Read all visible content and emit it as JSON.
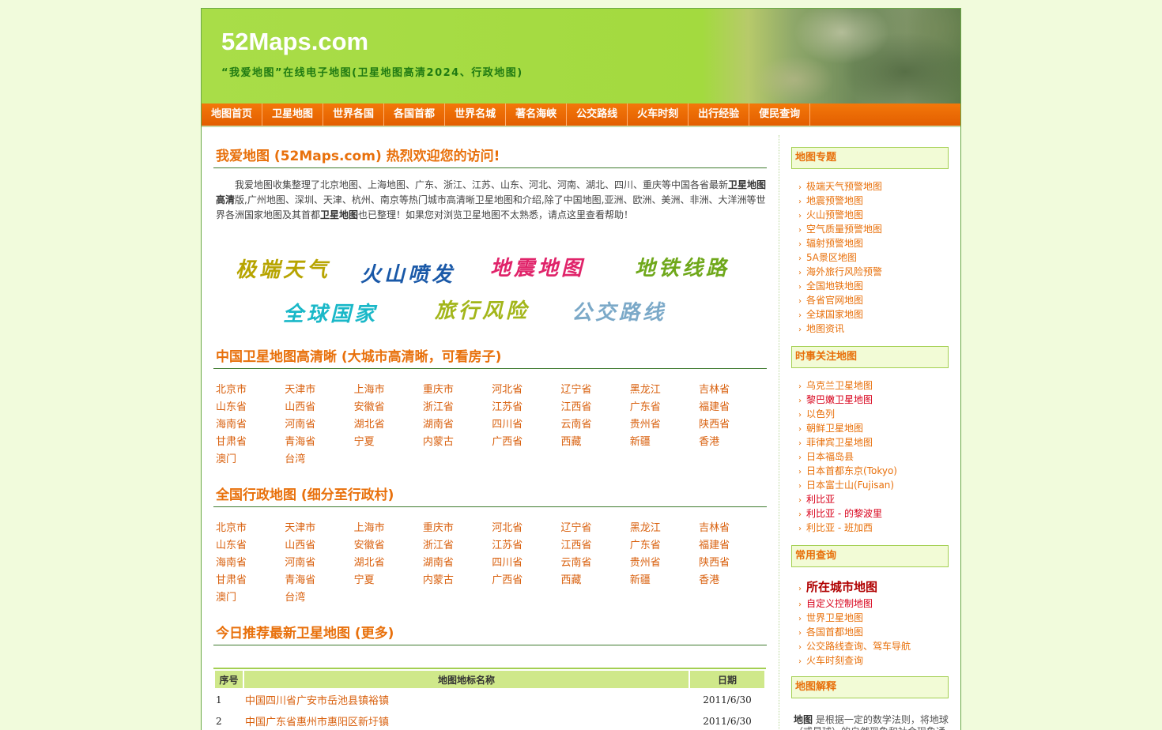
{
  "header": {
    "title": "52Maps.com",
    "slogan": "“我爱地图”在线电子地图(卫星地图高清2024、行政地图)"
  },
  "nav": [
    "地图首页",
    "卫星地图",
    "世界各国",
    "各国首都",
    "世界名城",
    "著名海峡",
    "公交路线",
    "火车时刻",
    "出行经验",
    "便民查询"
  ],
  "welcome": {
    "title": "我爱地图 (52Maps.com) 热烈欢迎您的访问!",
    "text_1": "我爱地图收集整理了北京地图、上海地图、广东、浙江、江苏、山东、河北、河南、湖北、四川、重庆等中国各省最新",
    "bold_1": "卫星地图高清",
    "text_2": "版,广州地图、深圳、天津、杭州、南京等热门城市高清晰卫星地图和介绍,除了中国地图,亚洲、欧洲、美洲、非洲、大洋洲等世界各洲国家地图及其首都",
    "bold_2": "卫星地图",
    "text_3": "也已整理！如果您对浏览卫星地图不太熟悉，请点这里查看帮助！"
  },
  "callouts": [
    {
      "label": "极端天气",
      "color": "#b7a400"
    },
    {
      "label": "火山喷发",
      "color": "#1a59a8"
    },
    {
      "label": "地震地图",
      "color": "#e0246a"
    },
    {
      "label": "地铁线路",
      "color": "#6fa81b"
    },
    {
      "label": "全球国家",
      "color": "#1ab8c8"
    },
    {
      "label": "旅行风险",
      "color": "#a3b61a"
    },
    {
      "label": "公交路线",
      "color": "#7ba9c8"
    }
  ],
  "sections": {
    "satellite_title": "中国卫星地图高清晰 (大城市高清晰，可看房子)",
    "admin_title": "全国行政地图 (细分至行政村)",
    "recommend_title": "今日推荐最新卫星地图 (更多)"
  },
  "provinces": [
    "北京市",
    "天津市",
    "上海市",
    "重庆市",
    "河北省",
    "辽宁省",
    "黑龙江",
    "吉林省",
    "山东省",
    "山西省",
    "安徽省",
    "浙江省",
    "江苏省",
    "江西省",
    "广东省",
    "福建省",
    "海南省",
    "河南省",
    "湖北省",
    "湖南省",
    "四川省",
    "云南省",
    "贵州省",
    "陕西省",
    "甘肃省",
    "青海省",
    "宁夏",
    "内蒙古",
    "广西省",
    "西藏",
    "新疆",
    "香港",
    "澳门",
    "台湾"
  ],
  "table": {
    "headers": [
      "序号",
      "地图地标名称",
      "日期"
    ],
    "rows": [
      {
        "num": "1",
        "name": "中国四川省广安市岳池县镇裕镇",
        "date": "2011/6/30"
      },
      {
        "num": "2",
        "name": "中国广东省惠州市惠阳区新圩镇",
        "date": "2011/6/30"
      }
    ]
  },
  "sidebar": {
    "topics_title": "地图专题",
    "topics": [
      "极端天气预警地图",
      "地震预警地图",
      "火山预警地图",
      "空气质量预警地图",
      "辐射预警地图",
      "5A景区地图",
      "海外旅行风险预警",
      "全国地铁地图",
      "各省官网地图",
      "全球国家地图",
      "地图资讯"
    ],
    "news_title": "时事关注地图",
    "news": [
      {
        "label": "乌克兰卫星地图",
        "red": false
      },
      {
        "label": "黎巴嫩卫星地图",
        "red": true
      },
      {
        "label": "以色列",
        "red": false
      },
      {
        "label": "朝鲜卫星地图",
        "red": false
      },
      {
        "label": "菲律宾卫星地图",
        "red": false
      },
      {
        "label": "日本福岛县",
        "red": false
      },
      {
        "label": "日本首都东京(Tokyo)",
        "red": false
      },
      {
        "label": "日本富士山(Fujisan)",
        "red": false
      },
      {
        "label": "利比亚",
        "red": true
      },
      {
        "label": "利比亚 - 的黎波里",
        "red": true
      },
      {
        "label": "利比亚 - 班加西",
        "red": false
      }
    ],
    "query_title": "常用查询",
    "query": [
      {
        "label": "所在城市地图",
        "style": "big"
      },
      {
        "label": "自定义控制地图",
        "style": "red"
      },
      {
        "label": "世界卫星地图",
        "style": ""
      },
      {
        "label": "各国首都地图",
        "style": ""
      },
      {
        "label": "公交路线查询、驾车导航",
        "style": ""
      },
      {
        "label": "火车时刻查询",
        "style": ""
      }
    ],
    "explain_title": "地图解释",
    "explain_bold": "地图",
    "explain_text": " 是根据一定的数学法则，将地球（或星球）的自然现象和社会现象通"
  }
}
